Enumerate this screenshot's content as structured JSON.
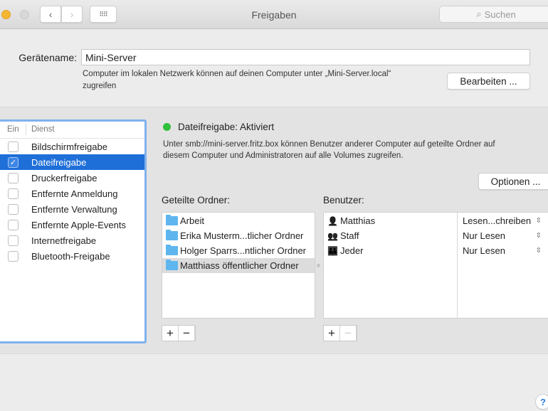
{
  "window": {
    "title": "Freigaben",
    "search_placeholder": "Suchen"
  },
  "device": {
    "label": "Gerätename:",
    "value": "Mini-Server",
    "description_line1": "Computer im lokalen Netzwerk können auf deinen Computer unter „Mini-Server.local“",
    "description_line2": "zugreifen",
    "edit_button": "Bearbeiten ..."
  },
  "services": {
    "col_on": "Ein",
    "col_service": "Dienst",
    "items": [
      {
        "label": "Bildschirmfreigabe",
        "checked": false
      },
      {
        "label": "Dateifreigabe",
        "checked": true
      },
      {
        "label": "Druckerfreigabe",
        "checked": false
      },
      {
        "label": "Entfernte Anmeldung",
        "checked": false
      },
      {
        "label": "Entfernte Verwaltung",
        "checked": false
      },
      {
        "label": "Entfernte Apple-Events",
        "checked": false
      },
      {
        "label": "Internetfreigabe",
        "checked": false
      },
      {
        "label": "Bluetooth-Freigabe",
        "checked": false
      }
    ]
  },
  "status": {
    "title": "Dateifreigabe: Aktiviert",
    "color": "#2fbf3a",
    "desc_line1": "Unter smb://mini-server.fritz.box können Benutzer anderer Computer auf geteilte Ordner auf",
    "desc_line2": "diesem Computer und Administratoren auf alle Volumes zugreifen.",
    "options_button": "Optionen ..."
  },
  "folders": {
    "label": "Geteilte Ordner:",
    "items": [
      "Arbeit",
      "Erika Musterm...tlicher Ordner",
      "Holger Sparrs...ntlicher Ordner",
      "Matthiass öffentlicher Ordner"
    ]
  },
  "users": {
    "label": "Benutzer:",
    "items": [
      {
        "name": "Matthias",
        "permission": "Lesen...chreiben"
      },
      {
        "name": "Staff",
        "permission": "Nur Lesen"
      },
      {
        "name": "Jeder",
        "permission": "Nur Lesen"
      }
    ]
  },
  "buttons": {
    "add": "+",
    "remove": "−",
    "help": "?"
  }
}
